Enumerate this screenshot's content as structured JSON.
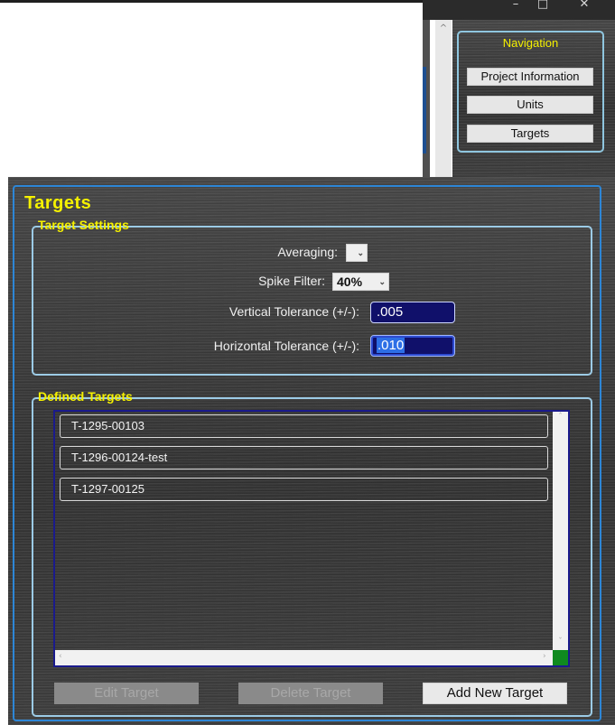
{
  "window": {
    "minimize_glyph": "–",
    "maximize_glyph": "□",
    "close_glyph": "✕",
    "scroll_up_glyph": "^"
  },
  "navigation": {
    "title": "Navigation",
    "items": [
      {
        "label": "Project Information"
      },
      {
        "label": "Units"
      },
      {
        "label": "Targets"
      }
    ]
  },
  "page": {
    "title": "Targets"
  },
  "target_settings": {
    "legend": "Target Settings",
    "averaging_label": "Averaging:",
    "averaging_value": "",
    "spike_filter_label": "Spike Filter:",
    "spike_filter_value": "40%",
    "vertical_tolerance_label": "Vertical Tolerance (+/-):",
    "vertical_tolerance_value": ".005",
    "horizontal_tolerance_label": "Horizontal Tolerance (+/-):",
    "horizontal_tolerance_value": ".010"
  },
  "defined_targets": {
    "legend": "Defined Targets",
    "items": [
      {
        "label": "T-1295-00103"
      },
      {
        "label": "T-1296-00124-test"
      },
      {
        "label": "T-1297-00125"
      }
    ]
  },
  "actions": {
    "edit_label": "Edit Target",
    "delete_label": "Delete Target",
    "add_label": "Add New Target"
  },
  "colors": {
    "accent_yellow": "#f5f100",
    "border_blue": "#2d86d6",
    "field_navy": "#10106a",
    "scroll_corner_green": "#0f8a1f"
  }
}
